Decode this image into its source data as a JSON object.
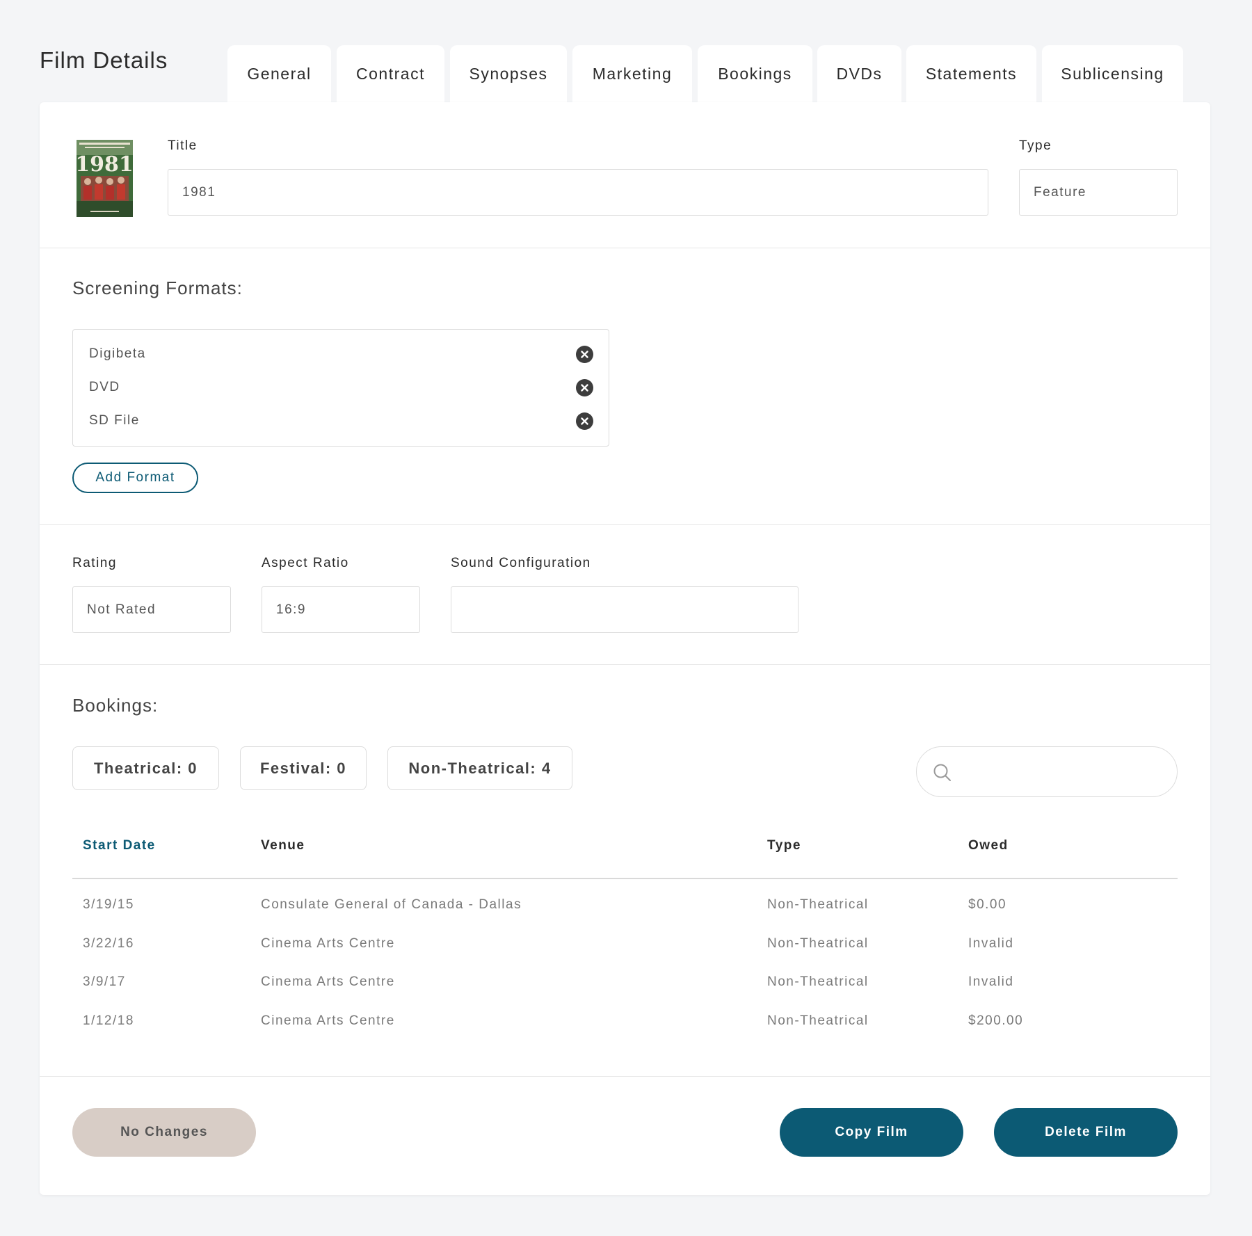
{
  "page": {
    "title": "Film Details"
  },
  "tabs": [
    {
      "label": "General"
    },
    {
      "label": "Contract"
    },
    {
      "label": "Synopses"
    },
    {
      "label": "Marketing"
    },
    {
      "label": "Bookings"
    },
    {
      "label": "DVDs"
    },
    {
      "label": "Statements"
    },
    {
      "label": "Sublicensing"
    }
  ],
  "poster": {
    "title": "1981"
  },
  "film": {
    "title_label": "Title",
    "title_value": "1981",
    "type_label": "Type",
    "type_value": "Feature"
  },
  "screening_formats": {
    "heading": "Screening Formats:",
    "items": [
      {
        "label": "Digibeta"
      },
      {
        "label": "DVD"
      },
      {
        "label": "SD File"
      }
    ],
    "add_label": "Add Format"
  },
  "specs": {
    "rating_label": "Rating",
    "rating_value": "Not Rated",
    "aspect_label": "Aspect Ratio",
    "aspect_value": "16:9",
    "sound_label": "Sound Configuration",
    "sound_value": ""
  },
  "bookings": {
    "heading": "Bookings:",
    "filters": [
      {
        "label": "Theatrical: 0"
      },
      {
        "label": "Festival: 0"
      },
      {
        "label": "Non-Theatrical: 4"
      }
    ],
    "search_value": "",
    "columns": [
      {
        "label": "Start Date",
        "active": true
      },
      {
        "label": "Venue"
      },
      {
        "label": "Type"
      },
      {
        "label": "Owed"
      }
    ],
    "rows": [
      {
        "start_date": "3/19/15",
        "venue": "Consulate General of Canada - Dallas",
        "type": "Non-Theatrical",
        "owed": "$0.00"
      },
      {
        "start_date": "3/22/16",
        "venue": "Cinema Arts Centre",
        "type": "Non-Theatrical",
        "owed": "Invalid"
      },
      {
        "start_date": "3/9/17",
        "venue": "Cinema Arts Centre",
        "type": "Non-Theatrical",
        "owed": "Invalid"
      },
      {
        "start_date": "1/12/18",
        "venue": "Cinema Arts Centre",
        "type": "Non-Theatrical",
        "owed": "$200.00"
      }
    ]
  },
  "actions": {
    "no_changes_label": "No Changes",
    "copy_label": "Copy Film",
    "delete_label": "Delete Film"
  },
  "colors": {
    "accent": "#0c5a74",
    "disabled_button": "#d8cdc6",
    "background": "#f4f5f7",
    "card": "#ffffff"
  },
  "icons": {
    "remove_format": "close-circle-icon",
    "search": "search-icon",
    "poster": "film-poster-image"
  }
}
